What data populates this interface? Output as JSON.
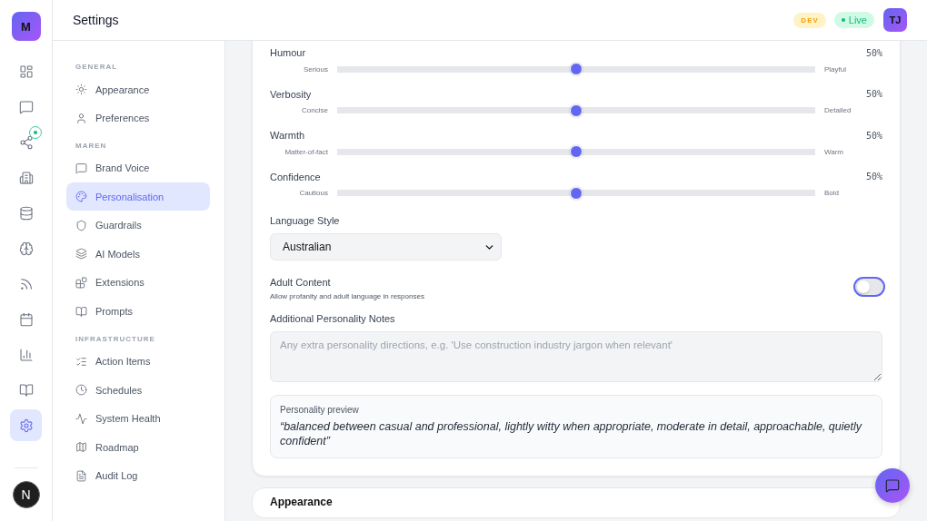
{
  "app": {
    "logo": "M",
    "user_initial": "N"
  },
  "rail": [
    {
      "selected": false,
      "badge": false
    },
    {
      "selected": false,
      "badge": false
    },
    {
      "selected": false,
      "badge": true
    },
    {
      "selected": false,
      "badge": false
    },
    {
      "selected": false,
      "badge": false
    },
    {
      "selected": false,
      "badge": false
    },
    {
      "selected": false,
      "badge": false
    },
    {
      "selected": false,
      "badge": false
    },
    {
      "selected": false,
      "badge": false
    },
    {
      "selected": false,
      "badge": false
    },
    {
      "selected": true,
      "badge": false
    }
  ],
  "header": {
    "title": "Settings",
    "env": "DEV",
    "status": "Live",
    "user": "TJ"
  },
  "sidebar": {
    "sections": [
      {
        "title": "GENERAL",
        "items": [
          {
            "label": "Appearance",
            "selected": false
          },
          {
            "label": "Preferences",
            "selected": false
          }
        ]
      },
      {
        "title": "MAREN",
        "items": [
          {
            "label": "Brand Voice",
            "selected": false
          },
          {
            "label": "Personalisation",
            "selected": true
          },
          {
            "label": "Guardrails",
            "selected": false
          },
          {
            "label": "AI Models",
            "selected": false
          },
          {
            "label": "Extensions",
            "selected": false
          },
          {
            "label": "Prompts",
            "selected": false
          }
        ]
      },
      {
        "title": "INFRASTRUCTURE",
        "items": [
          {
            "label": "Action Items",
            "selected": false
          },
          {
            "label": "Schedules",
            "selected": false
          },
          {
            "label": "System Health",
            "selected": false
          },
          {
            "label": "Roadmap",
            "selected": false
          },
          {
            "label": "Audit Log",
            "selected": false
          }
        ]
      }
    ]
  },
  "sliders": [
    {
      "label": "Humour",
      "min_label": "Serious",
      "max_label": "Playful",
      "reading": "50%",
      "level": 0.5
    },
    {
      "label": "Verbosity",
      "min_label": "Concise",
      "max_label": "Detailed",
      "reading": "50%",
      "level": 0.5
    },
    {
      "label": "Warmth",
      "min_label": "Matter-of-fact",
      "max_label": "Warm",
      "reading": "50%",
      "level": 0.5
    },
    {
      "label": "Confidence",
      "min_label": "Cautious",
      "max_label": "Bold",
      "reading": "50%",
      "level": 0.5
    }
  ],
  "language_style": {
    "label": "Language Style",
    "value": "Australian"
  },
  "adult_content": {
    "label": "Adult Content",
    "description": "Allow profanity and adult language in responses",
    "on": false
  },
  "notes": {
    "label": "Additional Personality Notes",
    "placeholder": "Any extra personality directions, e.g. 'Use construction industry jargon when relevant'"
  },
  "preview": {
    "title": "Personality preview",
    "text": "“balanced between casual and professional, lightly witty when appropriate, moderate in detail, approachable, quietly confident”"
  },
  "next_card": {
    "title": "Appearance"
  }
}
